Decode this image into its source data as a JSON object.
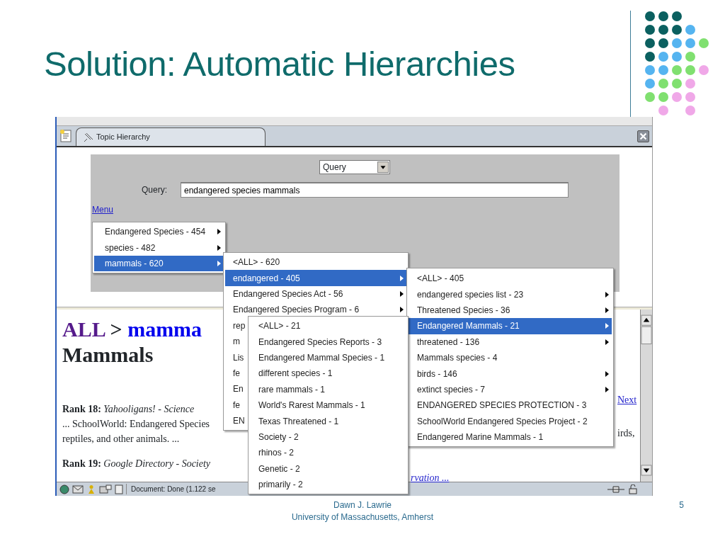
{
  "slide": {
    "title": "Solution: Automatic Hierarchies",
    "footer": {
      "author": "Dawn J. Lawrie",
      "affiliation": "University of Massachusetts, Amherst",
      "page": "5"
    }
  },
  "window": {
    "tab": {
      "label": "Topic Hierarchy",
      "selected": true
    }
  },
  "query_panel": {
    "mode_select": "Query",
    "query_label": "Query:",
    "query_value": "endangered species mammals",
    "menu_link": "Menu"
  },
  "menus": [
    {
      "items": [
        {
          "label": "Endangered Species - 454",
          "selected": false,
          "has_submenu": true
        },
        {
          "label": "species - 482",
          "selected": false,
          "has_submenu": true
        },
        {
          "label": "mammals - 620",
          "selected": true,
          "has_submenu": true
        }
      ]
    },
    {
      "items": [
        {
          "label": "<ALL> - 620",
          "selected": false,
          "has_submenu": false
        },
        {
          "label": "endangered - 405",
          "selected": true,
          "has_submenu": true
        },
        {
          "label": "Endangered Species Act - 56",
          "selected": false,
          "has_submenu": true
        },
        {
          "label": "Endangered Species Program - 6",
          "selected": false,
          "has_submenu": true
        },
        {
          "label": "rep",
          "selected": false,
          "has_submenu": false
        },
        {
          "label": "m",
          "selected": false,
          "has_submenu": false
        },
        {
          "label": "Lis",
          "selected": false,
          "has_submenu": false
        },
        {
          "label": "fe",
          "selected": false,
          "has_submenu": false
        },
        {
          "label": "En",
          "selected": false,
          "has_submenu": false
        },
        {
          "label": "fe",
          "selected": false,
          "has_submenu": false
        },
        {
          "label": "EN",
          "selected": false,
          "has_submenu": false
        }
      ]
    },
    {
      "items": [
        {
          "label": "<ALL> - 405",
          "selected": false,
          "has_submenu": false
        },
        {
          "label": "endangered species list - 23",
          "selected": false,
          "has_submenu": true
        },
        {
          "label": "Threatened Species - 36",
          "selected": false,
          "has_submenu": true
        },
        {
          "label": "Endangered Mammals - 21",
          "selected": true,
          "has_submenu": true
        },
        {
          "label": "threatened - 136",
          "selected": false,
          "has_submenu": true
        },
        {
          "label": "Mammals species - 4",
          "selected": false,
          "has_submenu": false
        },
        {
          "label": "birds - 146",
          "selected": false,
          "has_submenu": true
        },
        {
          "label": "extinct species - 7",
          "selected": false,
          "has_submenu": true
        },
        {
          "label": "ENDANGERED SPECIES PROTECTION - 3",
          "selected": false,
          "has_submenu": false
        },
        {
          "label": "SchoolWorld Endangered Species Project - 2",
          "selected": false,
          "has_submenu": false
        },
        {
          "label": "Endangered Marine Mammals - 1",
          "selected": false,
          "has_submenu": false
        }
      ]
    },
    {
      "items": [
        {
          "label": "<ALL> - 21",
          "selected": false,
          "has_submenu": false
        },
        {
          "label": "Endangered Species Reports - 3",
          "selected": false,
          "has_submenu": false
        },
        {
          "label": "Endangered Mammal Species - 1",
          "selected": false,
          "has_submenu": false
        },
        {
          "label": "different species - 1",
          "selected": false,
          "has_submenu": false
        },
        {
          "label": "rare mammals - 1",
          "selected": false,
          "has_submenu": false
        },
        {
          "label": "World's Rarest Mammals - 1",
          "selected": false,
          "has_submenu": false
        },
        {
          "label": "Texas Threatened - 1",
          "selected": false,
          "has_submenu": false
        },
        {
          "label": "Society - 2",
          "selected": false,
          "has_submenu": false
        },
        {
          "label": "rhinos - 2",
          "selected": false,
          "has_submenu": false
        },
        {
          "label": "Genetic - 2",
          "selected": false,
          "has_submenu": false
        },
        {
          "label": "primarily - 2",
          "selected": false,
          "has_submenu": false
        }
      ]
    }
  ],
  "results": {
    "breadcrumb": [
      {
        "label": "ALL",
        "visited": true
      },
      {
        "label": "mamma",
        "visited": false
      }
    ],
    "separator": ">",
    "heading": "Mammals",
    "next_link": "Next",
    "rank_18": {
      "label": "Rank 18:",
      "link": "Yahooligans! - Science",
      "snippet_1": "... SchoolWorld: Endangered Species",
      "snippet_1_end": "irds,",
      "snippet_2": "reptiles, and other animals. ..."
    },
    "rank_19": {
      "label": "Rank 19:",
      "link": "Google Directory - Society",
      "link_end": "rvation ..."
    }
  },
  "status_bar": {
    "text": "Document: Done (1.122 se"
  }
}
